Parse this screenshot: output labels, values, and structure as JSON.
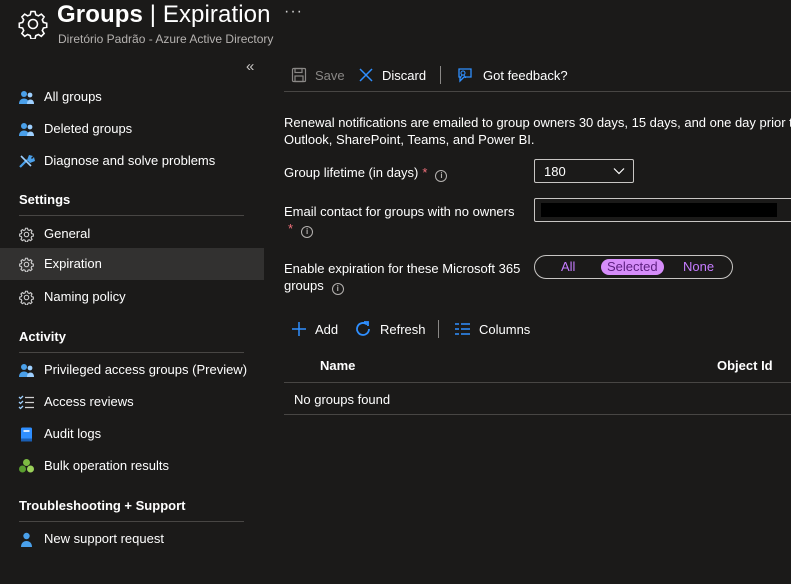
{
  "header": {
    "title_main": "Groups",
    "title_sep": "|",
    "title_page": "Expiration",
    "subtitle": "Diretório Padrão - Azure Active Directory",
    "more": "···"
  },
  "sidebar": {
    "collapse": "«",
    "top_items": [
      {
        "label": "All groups",
        "icon": "people-icon"
      },
      {
        "label": "Deleted groups",
        "icon": "people-icon"
      },
      {
        "label": "Diagnose and solve problems",
        "icon": "wrench-icon"
      }
    ],
    "sections": [
      {
        "heading": "Settings",
        "items": [
          {
            "label": "General",
            "icon": "gear-icon"
          },
          {
            "label": "Expiration",
            "icon": "gear-icon",
            "active": true
          },
          {
            "label": "Naming policy",
            "icon": "gear-icon"
          }
        ]
      },
      {
        "heading": "Activity",
        "items": [
          {
            "label": "Privileged access groups (Preview)",
            "icon": "people-icon"
          },
          {
            "label": "Access reviews",
            "icon": "checklist-icon"
          },
          {
            "label": "Audit logs",
            "icon": "book-icon"
          },
          {
            "label": "Bulk operation results",
            "icon": "clover-icon"
          }
        ]
      },
      {
        "heading": "Troubleshooting + Support",
        "items": [
          {
            "label": "New support request",
            "icon": "person-support-icon"
          }
        ]
      }
    ]
  },
  "toolbar": {
    "save": "Save",
    "discard": "Discard",
    "feedback": "Got feedback?"
  },
  "main": {
    "description": "Renewal notifications are emailed to group owners 30 days, 15 days, and one day prior to group expiration. Group owners must have Exchange licenses to receive notification emails. If a group is not renewed, it will be deleted along with its associated content from sources such as Outlook, SharePoint, Teams, and Power BI.",
    "description_visible_line1": "Renewal notifications are emailed to group owners 30 days, 15 days, and one day prior to",
    "description_visible_line2": "Outlook, SharePoint, Teams, and Power BI.",
    "lifetime_label": "Group lifetime (in days)",
    "lifetime_value": "180",
    "email_label": "Email contact for groups with no owners",
    "expiration_label_line1": "Enable expiration for these Microsoft 365",
    "expiration_label_line2": "groups",
    "required_mark": "*",
    "info_glyph": "i",
    "toggle_options": [
      "All",
      "Selected",
      "None"
    ],
    "toggle_selected": "Selected"
  },
  "commands": {
    "add": "Add",
    "refresh": "Refresh",
    "columns": "Columns"
  },
  "table": {
    "columns": [
      "Name",
      "Object Id"
    ],
    "empty": "No groups found"
  },
  "colors": {
    "background": "#1b1a19",
    "accent": "#2f8fff",
    "toggle_selected": "#d68df9",
    "toggle_text": "#c67cff",
    "required": "#f1707b"
  }
}
